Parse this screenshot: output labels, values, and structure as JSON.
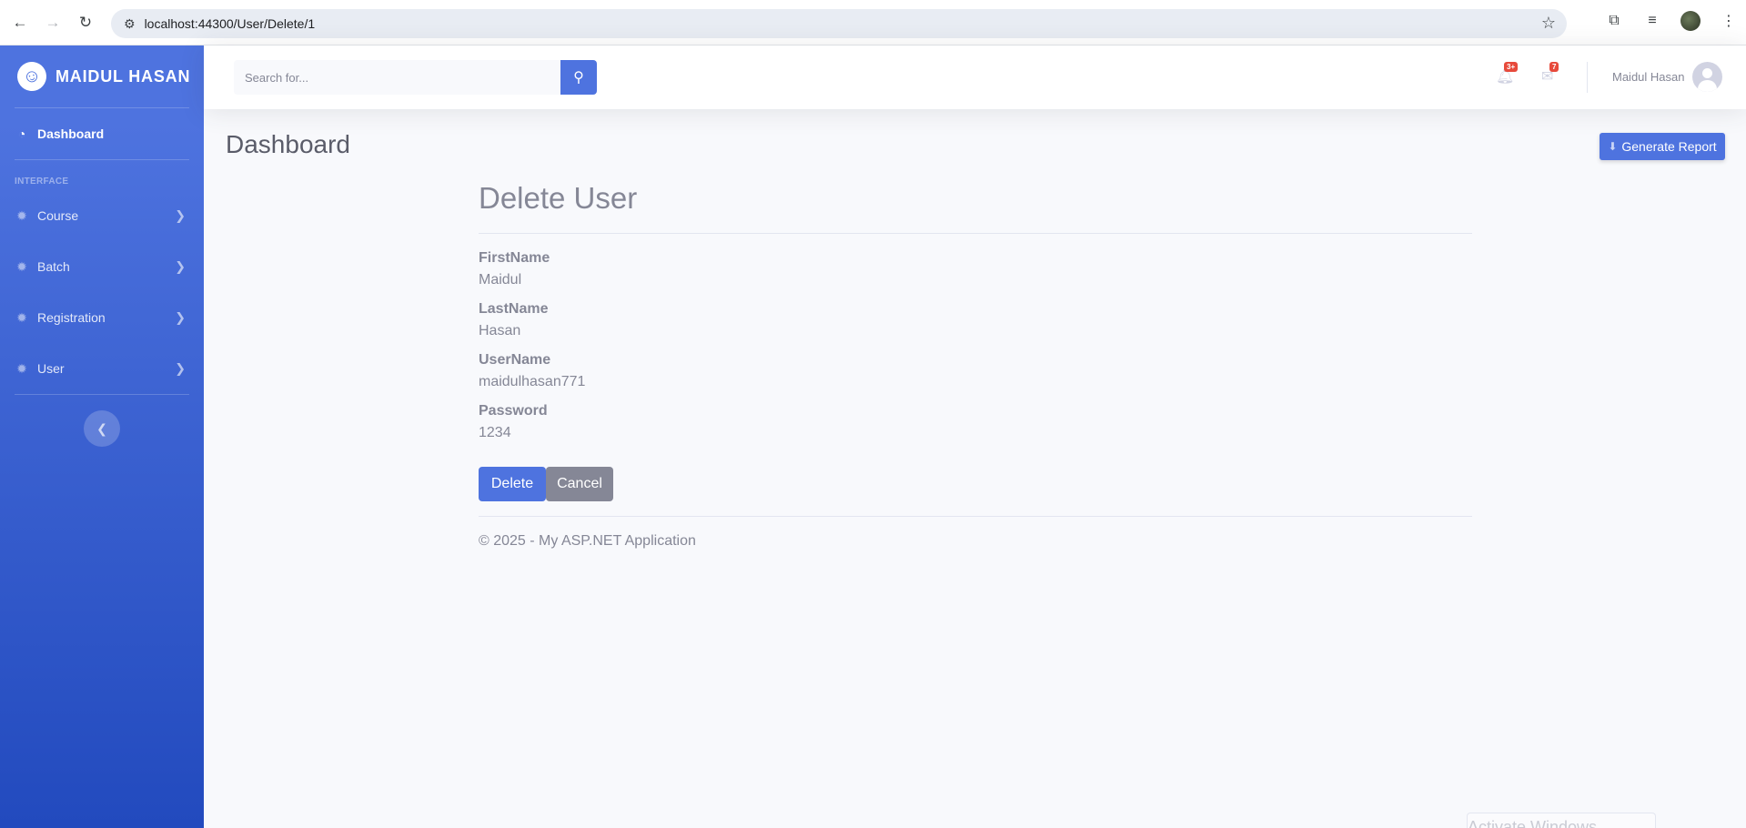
{
  "browser": {
    "url": "localhost:44300/User/Delete/1",
    "back_icon": "arrow-left-icon",
    "forward_icon": "arrow-right-icon",
    "reload_icon": "reload-icon"
  },
  "sidebar": {
    "brand": "MAIDUL HASAN",
    "dashboard_label": "Dashboard",
    "heading": "INTERFACE",
    "items": [
      {
        "label": "Course"
      },
      {
        "label": "Batch"
      },
      {
        "label": "Registration"
      },
      {
        "label": "User"
      }
    ]
  },
  "topbar": {
    "search_placeholder": "Search for...",
    "alerts_badge": "3+",
    "messages_badge": "7",
    "user_name": "Maidul Hasan"
  },
  "page": {
    "heading": "Dashboard",
    "generate_report_label": "Generate Report"
  },
  "form": {
    "title": "Delete User",
    "fields": [
      {
        "label": "FirstName",
        "value": "Maidul"
      },
      {
        "label": "LastName",
        "value": "Hasan"
      },
      {
        "label": "UserName",
        "value": "maidulhasan771"
      },
      {
        "label": "Password",
        "value": "1234"
      }
    ],
    "delete_label": "Delete",
    "cancel_label": "Cancel"
  },
  "footer": {
    "text": "© 2025 - My ASP.NET Application"
  },
  "overlay": {
    "activate_text": "Activate Windows"
  },
  "colors": {
    "primary": "#4e73df",
    "secondary": "#858796",
    "danger_badge": "#e74a3b",
    "sidebar_gradient_end": "#224abe"
  }
}
